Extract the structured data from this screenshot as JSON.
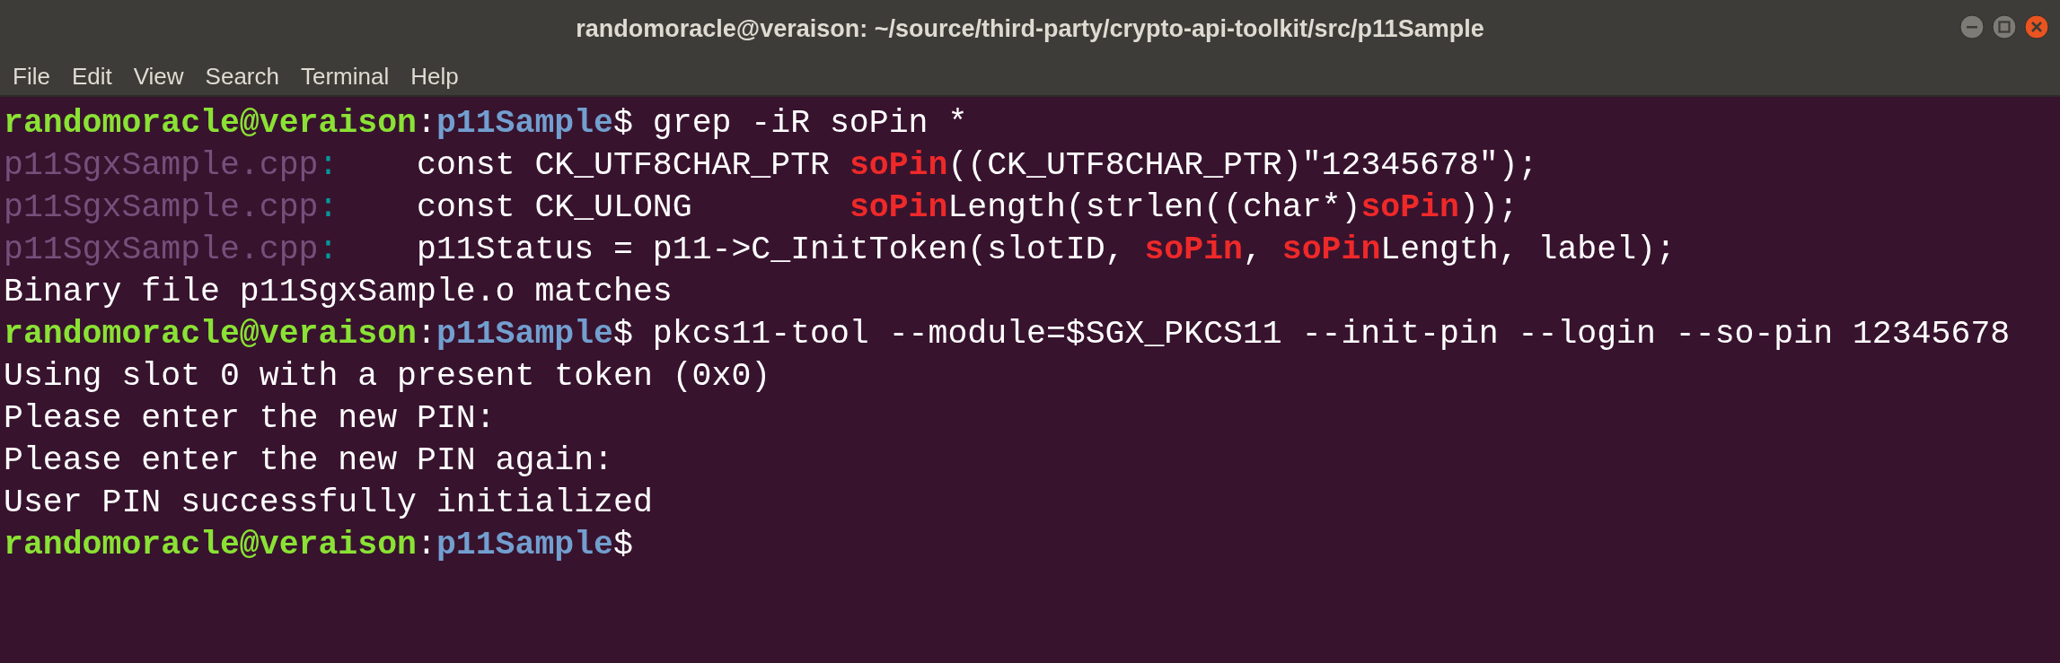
{
  "window": {
    "title": "randomoracle@veraison: ~/source/third-party/crypto-api-toolkit/src/p11Sample"
  },
  "menu": [
    "File",
    "Edit",
    "View",
    "Search",
    "Terminal",
    "Help"
  ],
  "terminal_lines": [
    [
      {
        "kind": "user",
        "text": "randomoracle@veraison"
      },
      {
        "kind": "plain",
        "text": ":"
      },
      {
        "kind": "path",
        "text": "p11Sample"
      },
      {
        "kind": "plain",
        "text": "$ grep -iR soPin *"
      }
    ],
    [
      {
        "kind": "file",
        "text": "p11SgxSample.cpp"
      },
      {
        "kind": "sep",
        "text": ":"
      },
      {
        "kind": "plain",
        "text": "    const CK_UTF8CHAR_PTR "
      },
      {
        "kind": "match",
        "text": "soPin"
      },
      {
        "kind": "plain",
        "text": "((CK_UTF8CHAR_PTR)\"12345678\");"
      }
    ],
    [
      {
        "kind": "file",
        "text": "p11SgxSample.cpp"
      },
      {
        "kind": "sep",
        "text": ":"
      },
      {
        "kind": "plain",
        "text": "    const CK_ULONG        "
      },
      {
        "kind": "match",
        "text": "soPin"
      },
      {
        "kind": "plain",
        "text": "Length(strlen((char*)"
      },
      {
        "kind": "match",
        "text": "soPin"
      },
      {
        "kind": "plain",
        "text": "));"
      }
    ],
    [
      {
        "kind": "file",
        "text": "p11SgxSample.cpp"
      },
      {
        "kind": "sep",
        "text": ":"
      },
      {
        "kind": "plain",
        "text": "    p11Status = p11->C_InitToken(slotID, "
      },
      {
        "kind": "match",
        "text": "soPin"
      },
      {
        "kind": "plain",
        "text": ", "
      },
      {
        "kind": "match",
        "text": "soPin"
      },
      {
        "kind": "plain",
        "text": "Length, label);"
      }
    ],
    [
      {
        "kind": "plain",
        "text": "Binary file p11SgxSample.o matches"
      }
    ],
    [
      {
        "kind": "user",
        "text": "randomoracle@veraison"
      },
      {
        "kind": "plain",
        "text": ":"
      },
      {
        "kind": "path",
        "text": "p11Sample"
      },
      {
        "kind": "plain",
        "text": "$ pkcs11-tool --module=$SGX_PKCS11 --init-pin --login --so-pin 12345678"
      }
    ],
    [
      {
        "kind": "plain",
        "text": "Using slot 0 with a present token (0x0)"
      }
    ],
    [
      {
        "kind": "plain",
        "text": "Please enter the new PIN:"
      }
    ],
    [
      {
        "kind": "plain",
        "text": "Please enter the new PIN again:"
      }
    ],
    [
      {
        "kind": "plain",
        "text": "User PIN successfully initialized"
      }
    ],
    [
      {
        "kind": "user",
        "text": "randomoracle@veraison"
      },
      {
        "kind": "plain",
        "text": ":"
      },
      {
        "kind": "path",
        "text": "p11Sample"
      },
      {
        "kind": "plain",
        "text": "$"
      }
    ]
  ]
}
